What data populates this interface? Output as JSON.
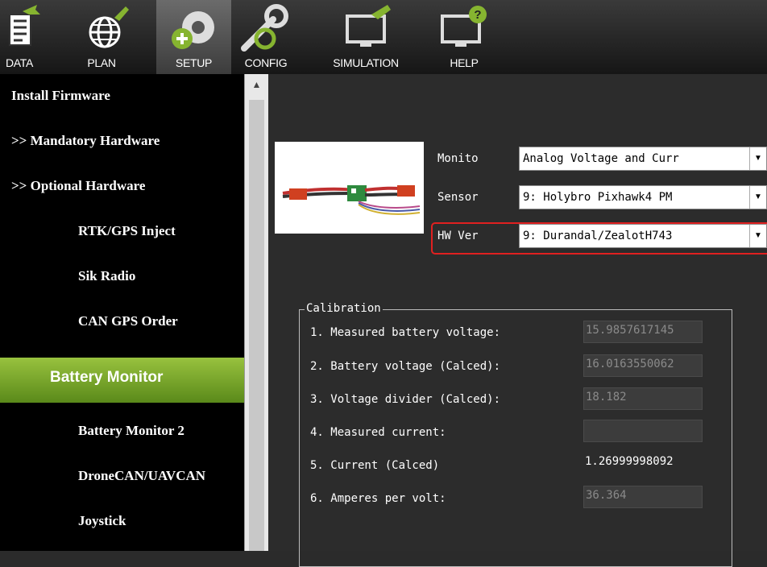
{
  "toolbar": {
    "items": [
      {
        "label": "DATA",
        "icon": "data-icon"
      },
      {
        "label": "PLAN",
        "icon": "plan-icon"
      },
      {
        "label": "SETUP",
        "icon": "setup-icon",
        "active": true
      },
      {
        "label": "CONFIG",
        "icon": "config-icon"
      },
      {
        "label": "SIMULATION",
        "icon": "simulation-icon"
      },
      {
        "label": "HELP",
        "icon": "help-icon"
      }
    ]
  },
  "sidebar": {
    "items": [
      {
        "label": "Install Firmware"
      },
      {
        "label": ">> Mandatory Hardware"
      },
      {
        "label": ">> Optional Hardware"
      },
      {
        "label": "RTK/GPS Inject"
      },
      {
        "label": "Sik Radio"
      },
      {
        "label": "CAN GPS Order"
      },
      {
        "label": "Battery Monitor",
        "active": true
      },
      {
        "label": "Battery Monitor 2"
      },
      {
        "label": "DroneCAN/UAVCAN"
      },
      {
        "label": "Joystick"
      }
    ]
  },
  "monitor": {
    "monitor_label": "Monito",
    "monitor_value": "Analog Voltage and Curr",
    "sensor_label": "Sensor",
    "sensor_value": "9: Holybro Pixhawk4 PM",
    "hwver_label": "HW Ver",
    "hwver_value": "9: Durandal/ZealotH743"
  },
  "calibration": {
    "title": "Calibration",
    "rows": [
      {
        "label": "1. Measured battery voltage:",
        "value": "15.9857617145"
      },
      {
        "label": "2. Battery voltage (Calced):",
        "value": "16.0163550062"
      },
      {
        "label": "3. Voltage divider (Calced):",
        "value": "18.182"
      },
      {
        "label": "4. Measured current:",
        "value": ""
      },
      {
        "label": "5. Current (Calced)",
        "value": "1.26999998092"
      },
      {
        "label": "6. Amperes per volt:",
        "value": "36.364"
      }
    ]
  },
  "colors": {
    "active_green": "#7fb02e",
    "highlight_red": "#e02020"
  }
}
